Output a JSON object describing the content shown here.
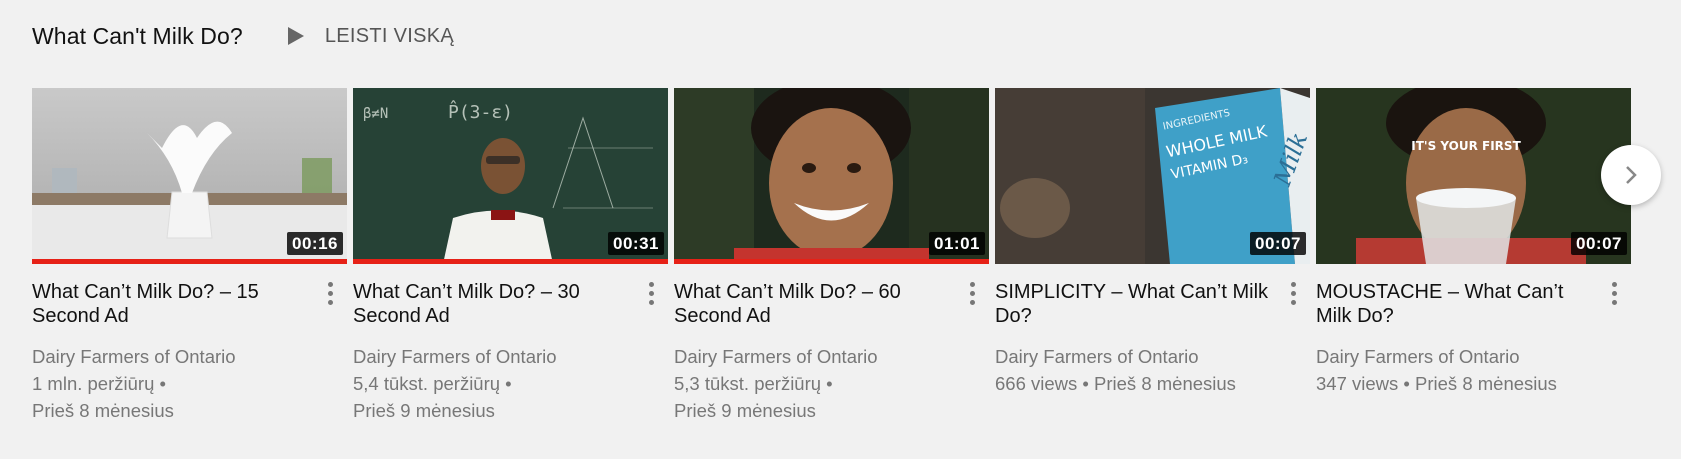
{
  "shelf": {
    "title": "What Can't Milk Do?",
    "play_all_label": "LEISTI VISKĄ",
    "play_icon": "play-icon",
    "next_icon": "chevron-right-icon"
  },
  "videos": [
    {
      "title": "What Can’t Milk Do? – 15 Second Ad",
      "duration": "00:16",
      "watched_fraction": 1.0,
      "channel": "Dairy Farmers of Ontario",
      "views": "1 mln. peržiūrų",
      "age": "Prieš 8 mėnesius"
    },
    {
      "title": "What Can’t Milk Do? – 30 Second Ad",
      "duration": "00:31",
      "watched_fraction": 1.0,
      "channel": "Dairy Farmers of Ontario",
      "views": "5,4 tūkst. peržiūrų",
      "age": "Prieš 9 mėnesius"
    },
    {
      "title": "What Can’t Milk Do? – 60 Second Ad",
      "duration": "01:01",
      "watched_fraction": 1.0,
      "channel": "Dairy Farmers of Ontario",
      "views": "5,3 tūkst. peržiūrų",
      "age": "Prieš 9 mėnesius"
    },
    {
      "title": "SIMPLICITY – What Can’t Milk Do?",
      "duration": "00:07",
      "watched_fraction": 0,
      "channel": "Dairy Farmers of Ontario",
      "views": "666 views",
      "age": "Prieš 8 mėnesius"
    },
    {
      "title": "MOUSTACHE – What Can’t Milk Do?",
      "duration": "00:07",
      "watched_fraction": 0,
      "channel": "Dairy Farmers of Ontario",
      "views": "347 views",
      "age": "Prieš 8 mėnesius",
      "thumb_text": "IT'S YOUR FIRST"
    }
  ],
  "thumb_text_3": {
    "line1": "INGREDIENTS",
    "line2": "WHOLE MILK",
    "line3": "VITAMIN D₃",
    "brand": "Milk"
  },
  "thumb_text_1": {
    "line1": "β≠N",
    "line2": "P̂(3-ε)"
  },
  "colors": {
    "progress": "#e62117",
    "background": "#f1f1f1"
  }
}
